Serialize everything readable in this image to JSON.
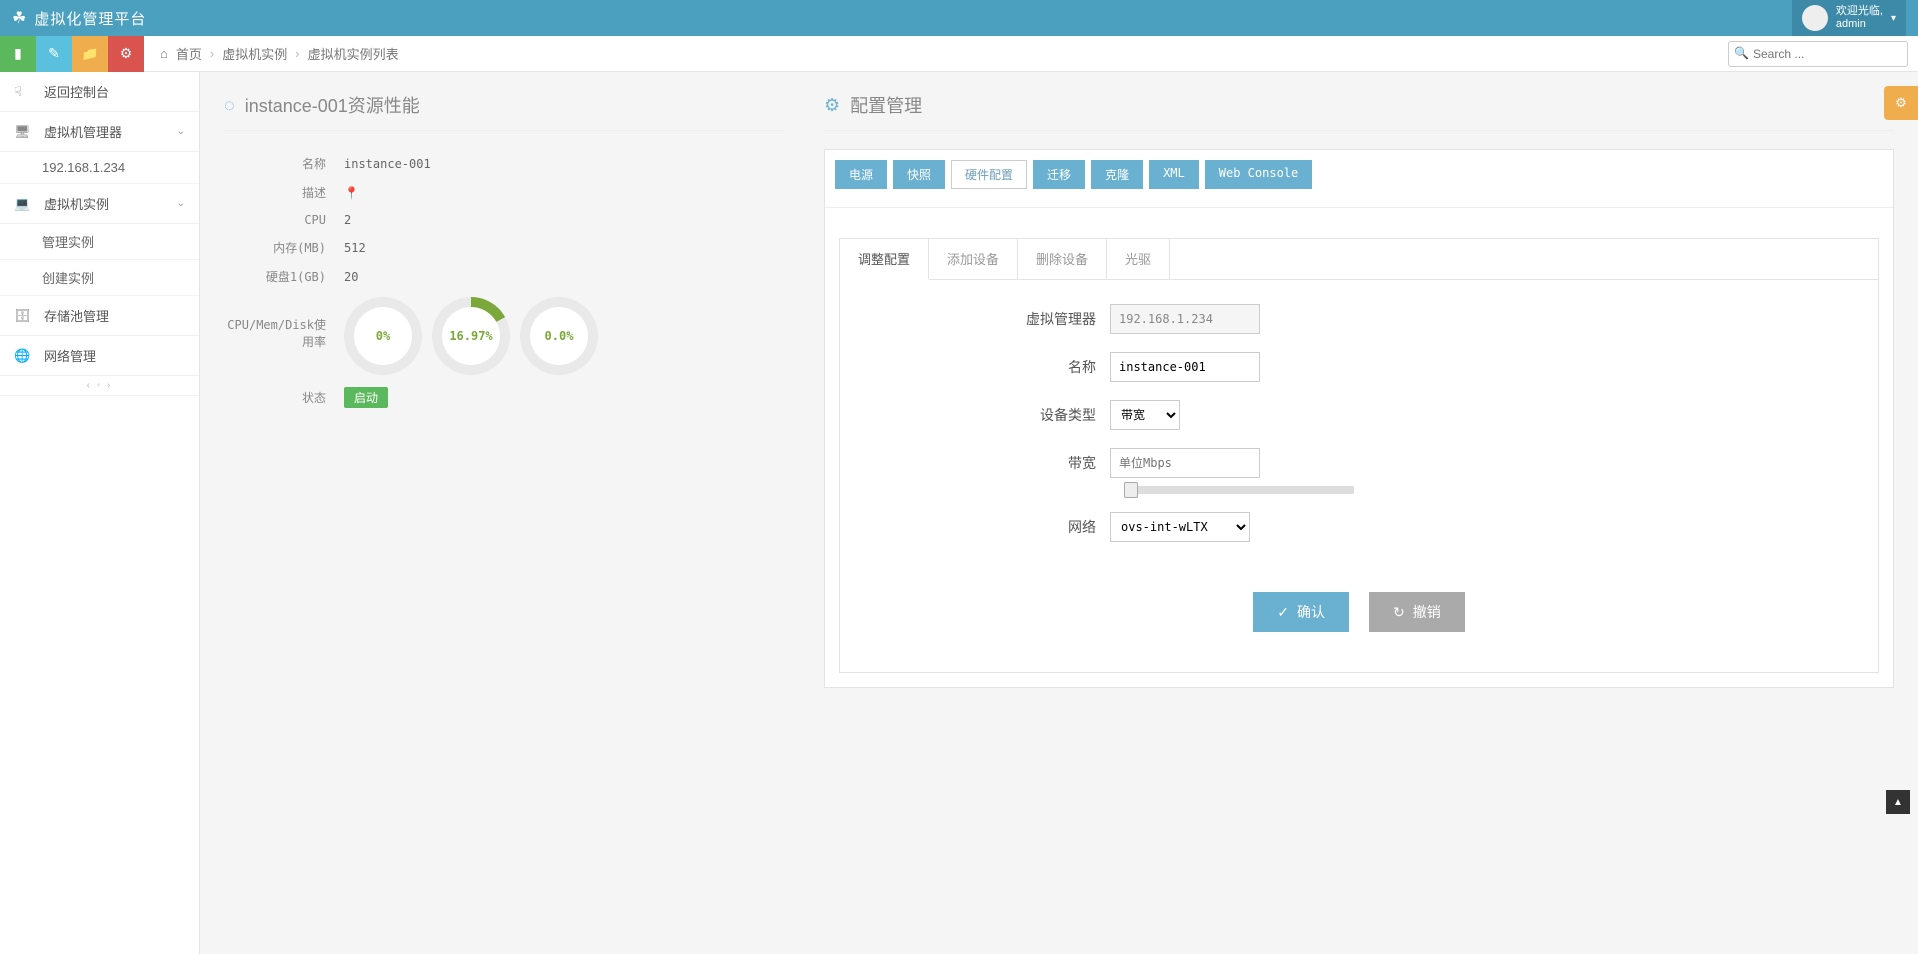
{
  "header": {
    "brand": "虚拟化管理平台",
    "user_greeting": "欢迎光临,",
    "user_name": "admin"
  },
  "breadcrumb": {
    "home": "首页",
    "l1": "虚拟机实例",
    "l2": "虚拟机实例列表"
  },
  "search": {
    "placeholder": "Search ..."
  },
  "sidebar": {
    "back": "返回控制台",
    "vm_manager": "虚拟机管理器",
    "host_ip": "192.168.1.234",
    "vm_instance": "虚拟机实例",
    "manage_instance": "管理实例",
    "create_instance": "创建实例",
    "storage": "存储池管理",
    "network": "网络管理"
  },
  "left_panel": {
    "title_prefix": "instance-001",
    "title_suffix": "资源性能",
    "rows": {
      "name_lbl": "名称",
      "name_val": "instance-001",
      "desc_lbl": "描述",
      "cpu_lbl": "CPU",
      "cpu_val": "2",
      "mem_lbl": "内存(MB)",
      "mem_val": "512",
      "disk_lbl": "硬盘1(GB)",
      "disk_val": "20",
      "usage_lbl": "CPU/Mem/Disk使用率",
      "gauge_cpu": "0%",
      "gauge_mem": "16.97%",
      "gauge_disk": "0.0%",
      "status_lbl": "状态",
      "status_val": "启动"
    }
  },
  "right_panel": {
    "title": "配置管理",
    "tabs1": {
      "power": "电源",
      "snapshot": "快照",
      "hardware": "硬件配置",
      "migrate": "迁移",
      "clone": "克隆",
      "xml": "XML",
      "webconsole": "Web Console"
    },
    "tabs2": {
      "adjust": "调整配置",
      "add": "添加设备",
      "remove": "删除设备",
      "cdrom": "光驱"
    },
    "form": {
      "manager_lbl": "虚拟管理器",
      "manager_val": "192.168.1.234",
      "name_lbl": "名称",
      "name_val": "instance-001",
      "devtype_lbl": "设备类型",
      "devtype_val": "带宽",
      "bw_lbl": "带宽",
      "bw_placeholder": "单位Mbps",
      "net_lbl": "网络",
      "net_val": "ovs-int-wLTX",
      "confirm": "确认",
      "cancel": "撤销"
    }
  }
}
